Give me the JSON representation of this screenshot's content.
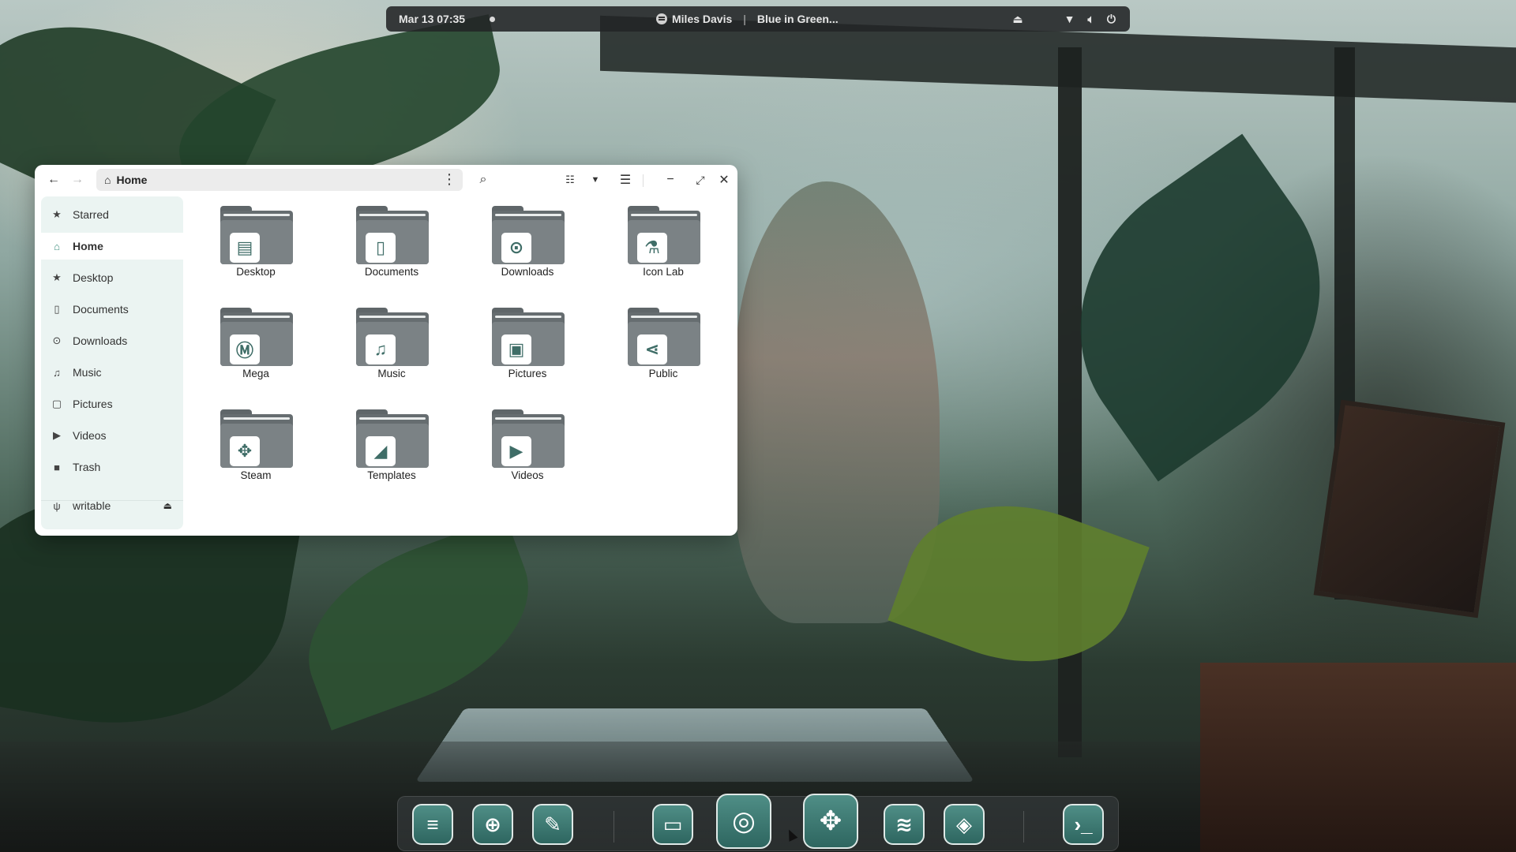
{
  "topbar": {
    "datetime": "Mar 13  07:35",
    "media_artist": "Miles Davis",
    "media_separator": "|",
    "media_track": "Blue in Green...",
    "tray_icons": [
      "eject-icon",
      "wifi-icon",
      "volume-icon",
      "power-icon"
    ]
  },
  "window": {
    "location": "Home",
    "sidebar": {
      "items": [
        {
          "label": "Starred",
          "icon": "star-icon"
        },
        {
          "label": "Home",
          "icon": "home-icon",
          "active": true
        },
        {
          "label": "Desktop",
          "icon": "star-icon"
        },
        {
          "label": "Documents",
          "icon": "document-icon"
        },
        {
          "label": "Downloads",
          "icon": "download-icon"
        },
        {
          "label": "Music",
          "icon": "music-icon"
        },
        {
          "label": "Pictures",
          "icon": "picture-icon"
        },
        {
          "label": "Videos",
          "icon": "play-icon"
        },
        {
          "label": "Trash",
          "icon": "trash-icon"
        }
      ],
      "device": {
        "label": "writable",
        "icon": "usb-icon"
      }
    },
    "folders": [
      {
        "label": "Desktop",
        "emblem": "desktop-icon"
      },
      {
        "label": "Documents",
        "emblem": "document-icon"
      },
      {
        "label": "Downloads",
        "emblem": "download-icon"
      },
      {
        "label": "Icon Lab",
        "emblem": "flask-icon"
      },
      {
        "label": "Mega",
        "emblem": "mega-icon"
      },
      {
        "label": "Music",
        "emblem": "music-icon"
      },
      {
        "label": "Pictures",
        "emblem": "picture-icon"
      },
      {
        "label": "Public",
        "emblem": "share-icon"
      },
      {
        "label": "Steam",
        "emblem": "gamepad-icon"
      },
      {
        "label": "Templates",
        "emblem": "template-icon"
      },
      {
        "label": "Videos",
        "emblem": "play-icon"
      }
    ]
  },
  "dock": {
    "apps": [
      "zorin-icon",
      "software-store-icon",
      "drawing-icon",
      "files-icon",
      "chrome-icon",
      "steam-gamepad-icon",
      "spotify-icon",
      "stacks-icon",
      "terminal-icon"
    ]
  },
  "colors": {
    "accent": "#3f8f7f",
    "sidebar_bg": "#ebf4f2",
    "folder": "#7b8285"
  }
}
